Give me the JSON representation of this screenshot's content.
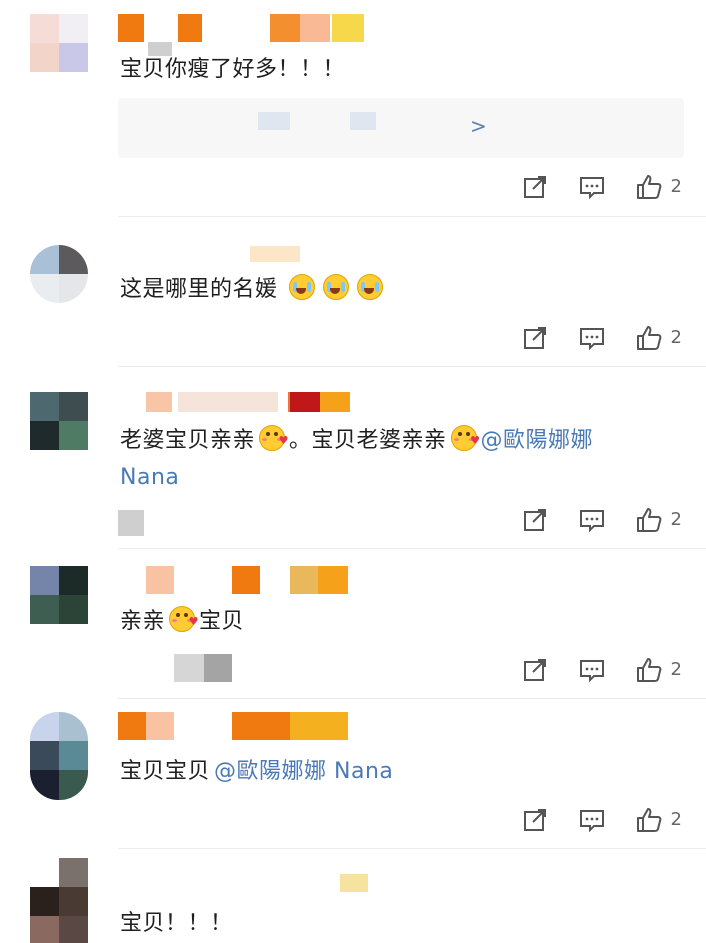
{
  "comments": [
    {
      "text": "宝贝你瘦了好多！！！",
      "likes": "2",
      "link_chevron": ">"
    },
    {
      "text": "这是哪里的名媛",
      "likes": "2"
    },
    {
      "text_a": "老婆宝贝亲亲",
      "text_b": "。宝贝老婆亲亲",
      "mention_a": "@歐陽娜娜",
      "mention_b": "Nana",
      "likes": "2"
    },
    {
      "text_a": "亲亲",
      "text_b": "宝贝",
      "likes": "2"
    },
    {
      "text": "宝贝宝贝",
      "mention": "@歐陽娜娜 Nana",
      "likes": "2"
    },
    {
      "text": "宝贝！！！"
    }
  ],
  "icons": {
    "share": "share-icon",
    "comment": "comment-icon",
    "like": "thumbs-up-icon"
  },
  "colors": {
    "mention": "#4a7ab5",
    "icon": "#555555",
    "divider": "#ececec"
  }
}
